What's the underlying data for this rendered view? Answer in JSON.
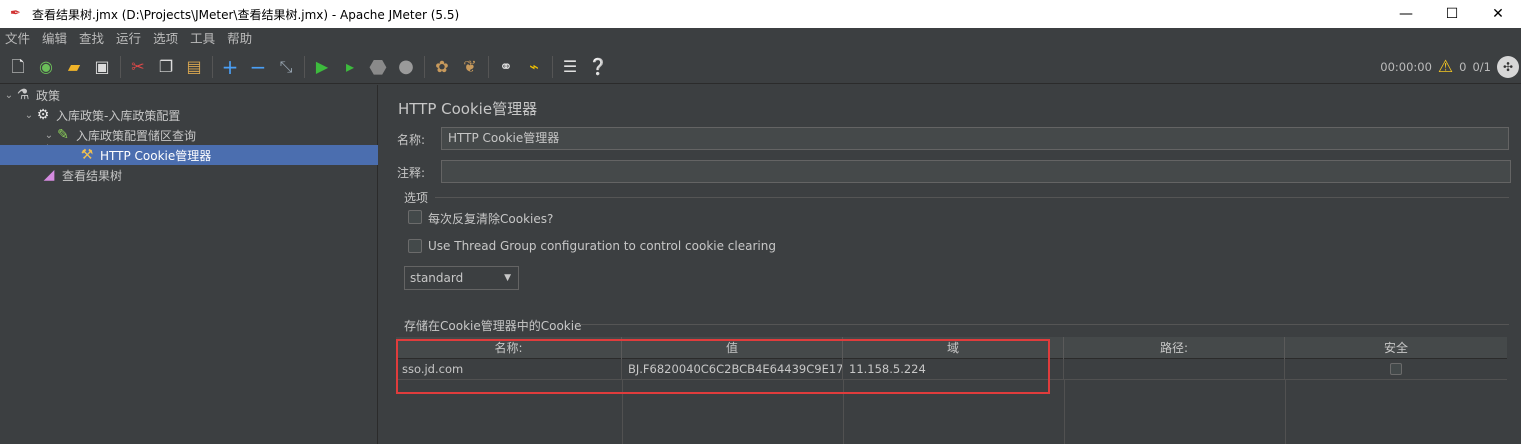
{
  "window": {
    "title": "查看结果树.jmx (D:\\Projects\\JMeter\\查看结果树.jmx) - Apache JMeter (5.5)",
    "minimize": "—",
    "maximize": "☐",
    "close": "✕"
  },
  "menu": [
    "文件",
    "编辑",
    "查找",
    "运行",
    "选项",
    "工具",
    "帮助"
  ],
  "toolbar": {
    "status_time": "00:00:00",
    "warnings": "0",
    "threads": "0/1"
  },
  "tree": {
    "items": [
      {
        "label": "政策",
        "icon": "test-plan-icon"
      },
      {
        "label": "入库政策-入库政策配置",
        "icon": "thread-group-gear-icon"
      },
      {
        "label": "入库政策配置储区查询",
        "icon": "http-sampler-pen-icon"
      },
      {
        "label": "HTTP Cookie管理器",
        "icon": "cookie-manager-tools-icon"
      },
      {
        "label": "查看结果树",
        "icon": "results-tree-chart-icon"
      }
    ]
  },
  "panel": {
    "title": "HTTP Cookie管理器",
    "name_label": "名称:",
    "name_value": "HTTP Cookie管理器",
    "comment_label": "注释:",
    "comment_value": "",
    "options_title": "选项",
    "clear_each_iteration": "每次反复清除Cookies?",
    "use_thread_group": "Use Thread Group configuration to control cookie clearing",
    "policy": "standard",
    "stored_cookies_title": "存储在Cookie管理器中的Cookie"
  },
  "table": {
    "headers": [
      "名称:",
      "值",
      "域",
      "路径:",
      "安全"
    ],
    "rows": [
      {
        "name": "sso.jd.com",
        "value": "BJ.F6820040C6C2BCB4E64439C9E17EC...",
        "domain": "11.158.5.224",
        "path": "",
        "secure": false
      }
    ]
  },
  "colors": {
    "background": "#3c3f41",
    "selection": "#4b6eaf",
    "highlight_box": "#e03c3c"
  }
}
